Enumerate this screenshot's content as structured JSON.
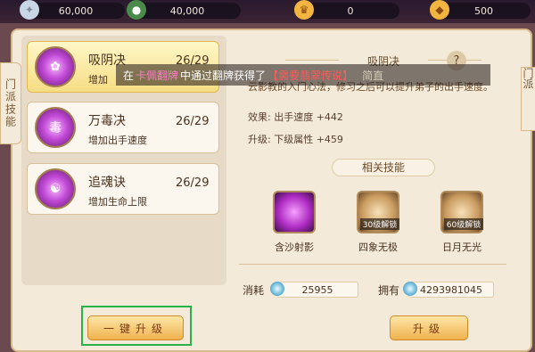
{
  "resources": [
    {
      "name": "resource-1",
      "value": "60,000",
      "icon_color": "#c9d6e6"
    },
    {
      "name": "resource-2",
      "value": "40,000",
      "icon_color": "#4a8a4a"
    },
    {
      "name": "resource-3",
      "value": "0",
      "icon_color": "#f2b640"
    },
    {
      "name": "resource-4",
      "value": "500",
      "icon_color": "#f2b640"
    }
  ],
  "side_tab_left": "门派技能",
  "side_tab_right": "门派",
  "skills": [
    {
      "name": "吸阴决",
      "level": "26/29",
      "desc": "增加"
    },
    {
      "name": "万毒决",
      "level": "26/29",
      "desc": "增加出手速度"
    },
    {
      "name": "追魂诀",
      "level": "26/29",
      "desc": "增加生命上限"
    }
  ],
  "upgrade_all_label": "一键升级",
  "detail": {
    "title": "吸阴决",
    "help": "?",
    "desc": "云影教的入门心法，修习之后可以提升弟子的出手速度。",
    "effect_label": "效果: 出手速度",
    "effect_value": "+442",
    "upgrade_label": "升级: 下级属性",
    "upgrade_value": "+459",
    "related_title": "相关技能",
    "related": [
      {
        "name": "含沙射影",
        "lock": ""
      },
      {
        "name": "四象无极",
        "lock": "30级解锁"
      },
      {
        "name": "日月无光",
        "lock": "60级解锁"
      }
    ],
    "cost_label": "消耗",
    "cost_value": "25955",
    "own_label": "拥有",
    "own_value": "4293981045",
    "upgrade_button": "升级"
  },
  "marquee": {
    "prefix": "在",
    "player": "卡佩翻牌",
    "middle": "中通过翻牌获得了",
    "item": "【需要翡翠传说】",
    "suffix": "简直"
  }
}
